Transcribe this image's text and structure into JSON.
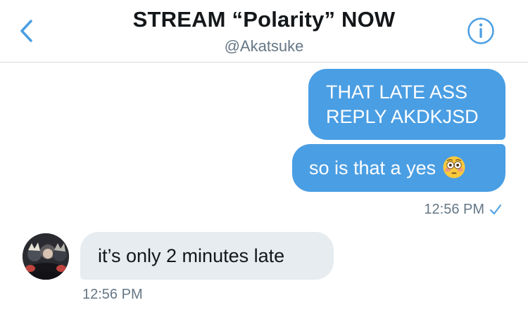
{
  "header": {
    "title": "STREAM “Polarity” NOW",
    "handle": "@Akatsuke",
    "back_icon": "chevron-left-icon",
    "info_icon": "info-icon"
  },
  "messages": [
    {
      "direction": "outgoing",
      "text": "THAT LATE ASS REPLY AKDKJSD"
    },
    {
      "direction": "outgoing",
      "text": "so is that a yes",
      "emoji": "flushed-face-emoji"
    },
    {
      "direction": "incoming",
      "text": "it’s only 2 minutes late",
      "avatar": "avatar"
    }
  ],
  "timestamps": {
    "outgoing": "12:56 PM",
    "incoming": "12:56 PM"
  },
  "status": {
    "icon": "checkmark-icon"
  },
  "colors": {
    "accent": "#4a9ee3",
    "incoming_bubble": "#e6ecf0",
    "secondary_text": "#657786",
    "primary_text": "#14171a",
    "divider": "#d4d8dc"
  }
}
